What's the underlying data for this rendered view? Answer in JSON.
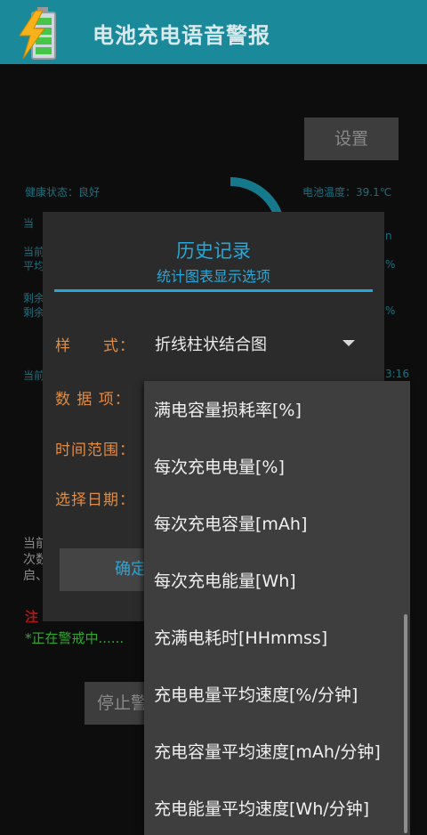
{
  "app": {
    "title": "电池充电语音警报"
  },
  "background": {
    "settings_button": "设置",
    "health": "健康状态：良好",
    "temperature": "电池温度：39.1℃",
    "left_fragments": [
      "当",
      "当前",
      "平均",
      "剩余",
      "剩余",
      "当前"
    ],
    "right_fragments": [
      "n",
      "%",
      "%",
      "3:16"
    ],
    "below_left": [
      "当前",
      "次数",
      "启、"
    ],
    "warning_prefix": "注",
    "alert_status": "*正在警戒中......",
    "stop_button": "停止警"
  },
  "dialog": {
    "title": "历史记录",
    "subtitle": "统计图表显示选项",
    "style_label": "样　　式：",
    "style_value": "折线柱状结合图",
    "data_label": "数 据 项：",
    "time_label": "时间范围：",
    "date_label": "选择日期：",
    "confirm": "确定"
  },
  "menu": {
    "items": [
      "满电容量损耗率[%]",
      "每次充电电量[%]",
      "每次充电容量[mAh]",
      "每次充电能量[Wh]",
      "充满电耗时[HHmmss]",
      "充电电量平均速度[%/分钟]",
      "充电容量平均速度[mAh/分钟]",
      "充电能量平均速度[Wh/分钟]"
    ]
  },
  "colors": {
    "appbar": "#1a8a9a",
    "accent": "#27a7d8",
    "label": "#e78a3b",
    "dialog": "#2b2b2b",
    "menu": "#3e3e3e"
  }
}
